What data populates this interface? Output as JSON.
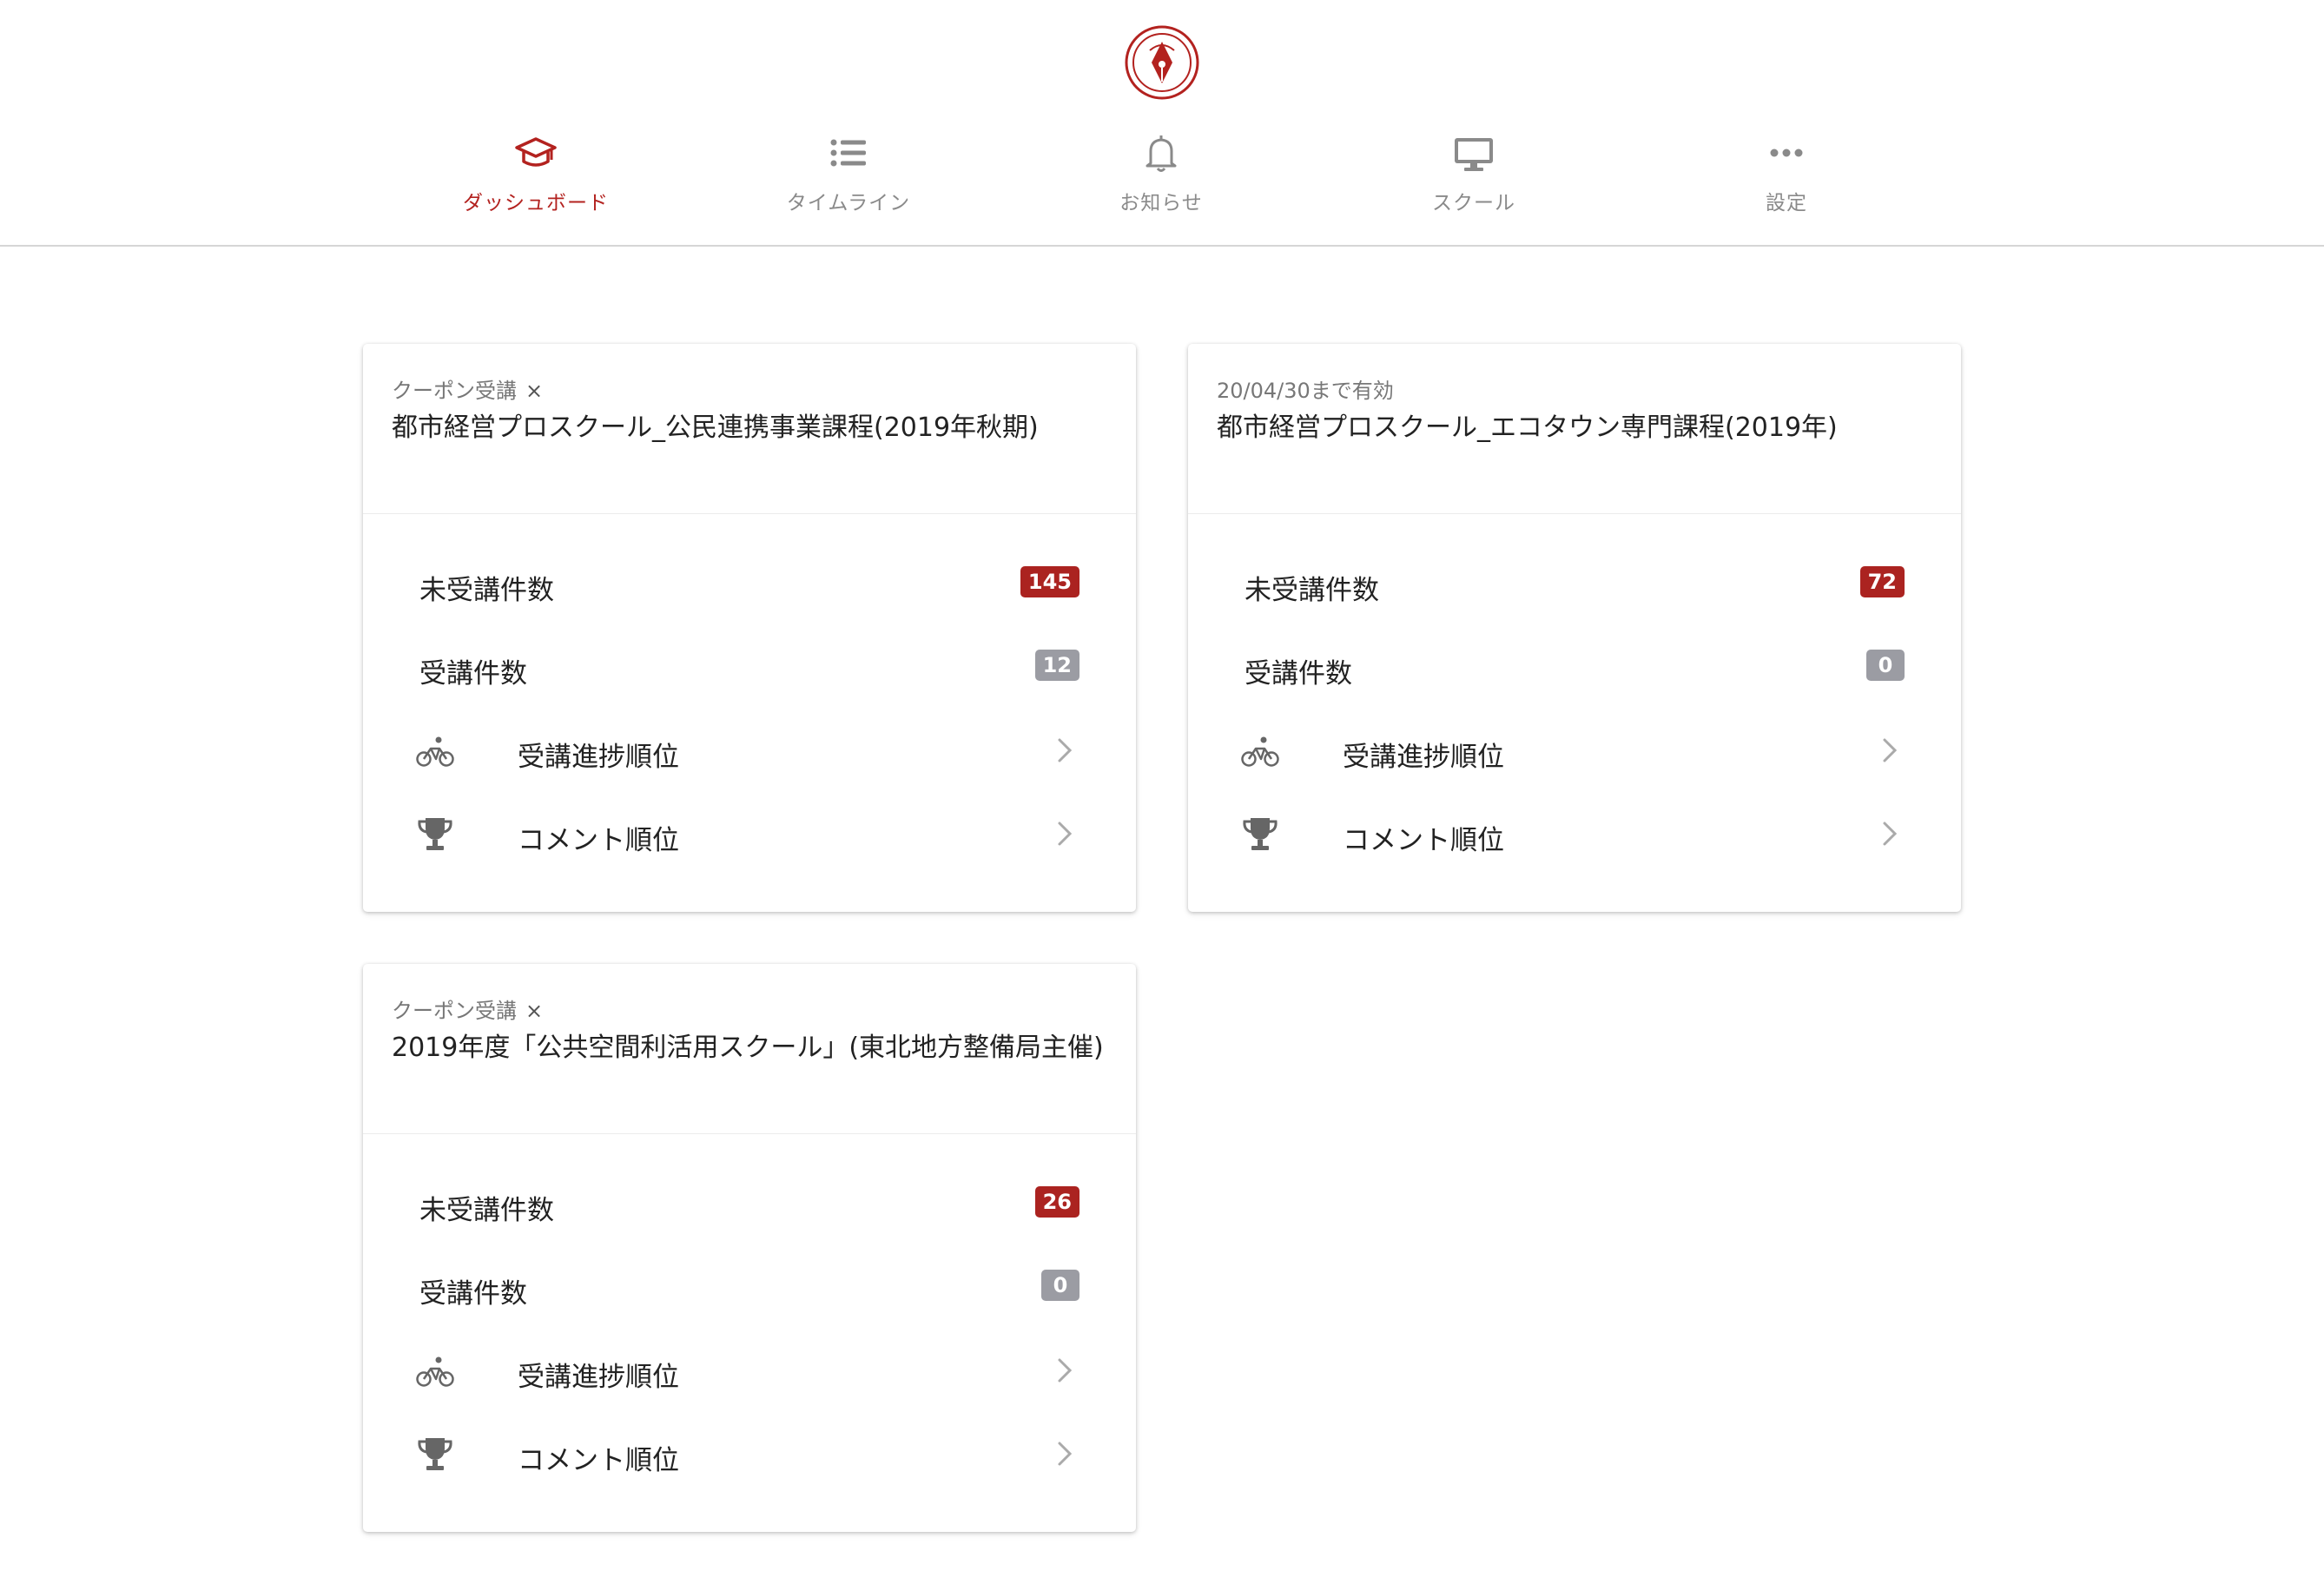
{
  "header": {
    "logo_alt": "AIRLEC",
    "nav": [
      {
        "label": "ダッシュボード",
        "icon": "graduation-cap-icon",
        "active": true
      },
      {
        "label": "タイムライン",
        "icon": "list-icon",
        "active": false
      },
      {
        "label": "お知らせ",
        "icon": "bell-icon",
        "active": false
      },
      {
        "label": "スクール",
        "icon": "monitor-icon",
        "active": false
      },
      {
        "label": "設定",
        "icon": "more-dots-icon",
        "active": false
      }
    ]
  },
  "colors": {
    "accent": "#b3221f",
    "badge_red": "#ab2320",
    "badge_gray": "#9b9ca3"
  },
  "cards": [
    {
      "subtitle": "クーポン受講",
      "close_label": "×",
      "title": "都市経営プロスクール_公民連携事業課程(2019年秋期)",
      "unattended_label": "未受講件数",
      "unattended_count": "145",
      "attended_label": "受講件数",
      "attended_count": "12",
      "progress_label": "受講進捗順位",
      "comment_label": "コメント順位"
    },
    {
      "subtitle": "20/04/30まで有効",
      "title": "都市経営プロスクール_エコタウン専門課程(2019年)",
      "unattended_label": "未受講件数",
      "unattended_count": "72",
      "attended_label": "受講件数",
      "attended_count": "0",
      "progress_label": "受講進捗順位",
      "comment_label": "コメント順位"
    },
    {
      "subtitle": "クーポン受講",
      "close_label": "×",
      "title": "2019年度「公共空間利活用スクール」(東北地方整備局主催)",
      "unattended_label": "未受講件数",
      "unattended_count": "26",
      "attended_label": "受講件数",
      "attended_count": "0",
      "progress_label": "受講進捗順位",
      "comment_label": "コメント順位"
    }
  ]
}
